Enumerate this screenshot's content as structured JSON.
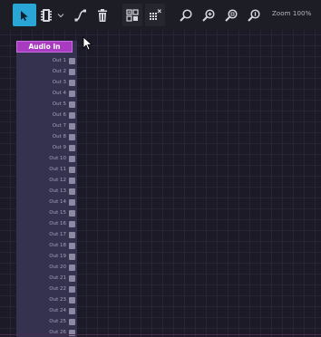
{
  "toolbar": {
    "tools": [
      {
        "name": "select-tool",
        "icon": "arrow-cursor-icon",
        "active": true
      },
      {
        "name": "module-tool",
        "icon": "chip-icon"
      },
      {
        "name": "module-dropdown",
        "icon": "chevron-down-icon"
      },
      {
        "name": "wire-tool",
        "icon": "wire-curve-icon"
      },
      {
        "name": "delete-tool",
        "icon": "trash-icon"
      },
      {
        "name": "group-tool",
        "icon": "group-nodes-icon"
      },
      {
        "name": "clear-grid-tool",
        "icon": "grid-clear-icon"
      },
      {
        "name": "zoom-out",
        "icon": "zoom-out-icon"
      },
      {
        "name": "zoom-in",
        "icon": "zoom-in-icon"
      },
      {
        "name": "zoom-fit",
        "icon": "zoom-fit-icon"
      },
      {
        "name": "zoom-reset",
        "icon": "zoom-reset-icon"
      }
    ],
    "zoom_label": "Zoom 100%"
  },
  "module": {
    "title": "Audio In",
    "ports": [
      "Out 1",
      "Out 2",
      "Out 3",
      "Out 4",
      "Out 5",
      "Out 6",
      "Out 7",
      "Out 8",
      "Out 9",
      "Out 10",
      "Out 11",
      "Out 12",
      "Out 13",
      "Out 14",
      "Out 15",
      "Out 16",
      "Out 17",
      "Out 18",
      "Out 19",
      "Out 20",
      "Out 21",
      "Out 22",
      "Out 23",
      "Out 24",
      "Out 25",
      "Out 26"
    ]
  },
  "colors": {
    "accent": "#29a6d6",
    "module_header": "#a83bc0",
    "module_body": "#35324f",
    "background": "#1b1a26"
  }
}
